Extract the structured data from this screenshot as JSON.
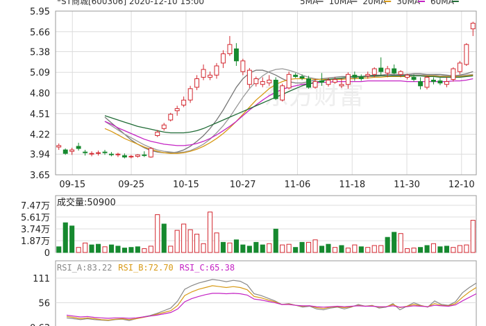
{
  "header": {
    "title": "*ST商城[600306] 2020-12-10 15:00",
    "ma_legend": [
      {
        "label": "5MA",
        "color": "#777777"
      },
      {
        "label": "10MA",
        "color": "#777777"
      },
      {
        "label": "20MA",
        "color": "#d89a16"
      },
      {
        "label": "30MA",
        "color": "#c422c4"
      },
      {
        "label": "60MA",
        "color": "#1f6b35"
      }
    ]
  },
  "volume_label": "成交量:50900",
  "rsi_legend": [
    {
      "label": "RSI_A:83.22",
      "color": "#888888"
    },
    {
      "label": "RSI_B:72.70",
      "color": "#d89a16"
    },
    {
      "label": "RSI_C:65.38",
      "color": "#c422c4"
    }
  ],
  "watermark": "东方财富",
  "colors": {
    "up": "#d3262e",
    "down": "#16892f",
    "grid": "#dcdcdc"
  },
  "chart_data": [
    {
      "type": "candlestick",
      "yticks": [
        3.65,
        3.94,
        4.22,
        4.51,
        4.8,
        5.09,
        5.38,
        5.66,
        5.95
      ],
      "ylim": [
        3.65,
        5.95
      ],
      "xticks": [
        "09-15",
        "09-25",
        "10-15",
        "10-27",
        "11-06",
        "11-18",
        "11-30",
        "12-10"
      ],
      "candles": [
        [
          4.04,
          4.09,
          4.0,
          4.06
        ],
        [
          4.0,
          4.02,
          3.93,
          3.95
        ],
        [
          3.98,
          4.03,
          3.93,
          4.0
        ],
        [
          4.05,
          4.1,
          3.99,
          4.02
        ],
        [
          3.97,
          4.0,
          3.92,
          3.96
        ],
        [
          3.94,
          3.98,
          3.91,
          3.95
        ],
        [
          3.95,
          3.99,
          3.92,
          3.96
        ],
        [
          3.97,
          4.0,
          3.93,
          3.96
        ],
        [
          3.94,
          3.97,
          3.91,
          3.93
        ],
        [
          3.93,
          3.96,
          3.9,
          3.94
        ],
        [
          3.92,
          3.95,
          3.88,
          3.9
        ],
        [
          3.9,
          3.93,
          3.88,
          3.91
        ],
        [
          3.91,
          3.94,
          3.89,
          3.93
        ],
        [
          3.93,
          3.98,
          3.9,
          3.92
        ],
        [
          3.9,
          4.04,
          3.89,
          4.02
        ],
        [
          4.2,
          4.28,
          4.18,
          4.25
        ],
        [
          4.3,
          4.38,
          4.27,
          4.35
        ],
        [
          4.42,
          4.52,
          4.4,
          4.5
        ],
        [
          4.55,
          4.62,
          4.48,
          4.58
        ],
        [
          4.63,
          4.75,
          4.6,
          4.7
        ],
        [
          4.7,
          4.9,
          4.66,
          4.86
        ],
        [
          4.88,
          5.05,
          4.84,
          5.0
        ],
        [
          5.02,
          5.2,
          4.98,
          5.13
        ],
        [
          5.02,
          5.1,
          4.98,
          5.05
        ],
        [
          5.05,
          5.22,
          5.0,
          5.18
        ],
        [
          5.22,
          5.4,
          5.15,
          5.35
        ],
        [
          5.35,
          5.6,
          5.32,
          5.48
        ],
        [
          5.42,
          5.5,
          5.18,
          5.25
        ],
        [
          5.1,
          5.28,
          5.05,
          5.25
        ],
        [
          4.92,
          5.15,
          4.87,
          5.12
        ],
        [
          4.93,
          5.03,
          4.89,
          5.0
        ],
        [
          4.92,
          5.02,
          4.88,
          4.96
        ],
        [
          4.94,
          5.05,
          4.9,
          4.98
        ],
        [
          4.98,
          5.02,
          4.7,
          4.72
        ],
        [
          4.7,
          4.93,
          4.68,
          4.9
        ],
        [
          4.87,
          5.1,
          4.85,
          5.06
        ],
        [
          5.05,
          5.08,
          5.01,
          5.03
        ],
        [
          5.03,
          5.06,
          4.98,
          5.01
        ],
        [
          5.0,
          5.04,
          4.86,
          4.88
        ],
        [
          4.88,
          5.0,
          4.86,
          4.96
        ],
        [
          4.97,
          5.08,
          4.9,
          4.95
        ],
        [
          4.92,
          5.01,
          4.89,
          4.98
        ],
        [
          4.95,
          5.02,
          4.93,
          4.99
        ],
        [
          4.9,
          5.0,
          4.87,
          4.92
        ],
        [
          4.92,
          5.09,
          4.86,
          5.06
        ],
        [
          5.05,
          5.1,
          4.97,
          5.02
        ],
        [
          5.02,
          5.06,
          4.97,
          5.0
        ],
        [
          5.04,
          5.1,
          5.0,
          5.06
        ],
        [
          5.06,
          5.16,
          5.02,
          5.14
        ],
        [
          5.15,
          5.3,
          5.05,
          5.1
        ],
        [
          5.08,
          5.18,
          5.02,
          5.14
        ],
        [
          5.14,
          5.2,
          5.06,
          5.08
        ],
        [
          5.06,
          5.12,
          5.02,
          5.1
        ],
        [
          5.02,
          5.07,
          4.99,
          5.05
        ],
        [
          5.02,
          5.06,
          4.96,
          4.99
        ],
        [
          4.96,
          5.02,
          4.85,
          4.9
        ],
        [
          4.88,
          5.04,
          4.85,
          5.02
        ],
        [
          4.98,
          5.02,
          4.92,
          4.96
        ],
        [
          4.97,
          5.01,
          4.91,
          4.94
        ],
        [
          4.92,
          5.02,
          4.88,
          4.96
        ],
        [
          4.99,
          5.16,
          4.96,
          5.14
        ],
        [
          5.1,
          5.25,
          5.06,
          5.22
        ],
        [
          5.2,
          5.5,
          5.18,
          5.48
        ],
        [
          5.7,
          5.8,
          5.6,
          5.78
        ]
      ],
      "moving_averages": {
        "MA5": [
          4.46,
          4.38,
          4.3,
          4.22,
          4.14,
          4.08,
          4.03,
          3.99,
          3.97,
          3.96,
          3.96,
          3.97,
          4.0,
          4.05,
          4.12,
          4.2,
          4.3,
          4.42,
          4.56,
          4.72,
          4.88,
          5.0,
          5.08,
          5.12,
          5.12,
          5.09,
          5.05,
          5.0,
          4.96,
          4.94,
          4.94,
          4.96,
          4.98,
          5.0,
          5.01,
          5.02,
          5.03,
          5.03,
          5.03,
          5.03,
          5.04,
          5.05,
          5.05,
          5.06,
          5.06,
          5.06,
          5.06,
          5.07,
          5.07,
          5.06,
          5.06,
          5.06,
          5.05,
          5.04,
          5.05,
          5.07,
          5.1
        ],
        "MA10": [
          4.4,
          4.34,
          4.28,
          4.22,
          4.17,
          4.12,
          4.07,
          4.03,
          4.0,
          3.98,
          3.97,
          3.96,
          3.97,
          3.99,
          4.03,
          4.08,
          4.15,
          4.24,
          4.34,
          4.46,
          4.6,
          4.74,
          4.86,
          4.96,
          5.04,
          5.1,
          5.13,
          5.14,
          5.12,
          5.09,
          5.05,
          5.02,
          5.0,
          4.99,
          4.99,
          4.99,
          5.0,
          5.0,
          5.01,
          5.02,
          5.03,
          5.03,
          5.04,
          5.04,
          5.05,
          5.05,
          5.05,
          5.05,
          5.05,
          5.05,
          5.05,
          5.04,
          5.04,
          5.03,
          5.04,
          5.05,
          5.06
        ],
        "MA20": [
          4.3,
          4.26,
          4.21,
          4.16,
          4.12,
          4.08,
          4.04,
          4.01,
          3.98,
          3.96,
          3.95,
          3.95,
          3.96,
          3.98,
          4.01,
          4.05,
          4.1,
          4.16,
          4.23,
          4.31,
          4.4,
          4.5,
          4.6,
          4.7,
          4.78,
          4.86,
          4.92,
          4.96,
          4.99,
          5.0,
          5.0,
          5.0,
          4.99,
          4.99,
          4.99,
          4.99,
          4.99,
          5.0,
          5.0,
          5.01,
          5.01,
          5.02,
          5.02,
          5.03,
          5.03,
          5.03,
          5.03,
          5.04,
          5.04,
          5.04,
          5.04,
          5.03,
          5.03,
          5.03,
          5.03,
          5.04,
          5.05
        ],
        "MA30": [
          4.4,
          4.36,
          4.31,
          4.27,
          4.23,
          4.19,
          4.15,
          4.12,
          4.1,
          4.08,
          4.07,
          4.06,
          4.06,
          4.07,
          4.09,
          4.12,
          4.16,
          4.21,
          4.27,
          4.33,
          4.4,
          4.48,
          4.56,
          4.63,
          4.7,
          4.76,
          4.81,
          4.85,
          4.88,
          4.9,
          4.92,
          4.93,
          4.94,
          4.95,
          4.95,
          4.96,
          4.96,
          4.96,
          4.96,
          4.96,
          4.97,
          4.97,
          4.97,
          4.97,
          4.97,
          4.97,
          4.96,
          4.96,
          4.96,
          4.96,
          4.96,
          4.96,
          4.96,
          4.97,
          4.97,
          4.98,
          5.0
        ],
        "MA60": [
          4.48,
          4.45,
          4.42,
          4.39,
          4.36,
          4.33,
          4.31,
          4.29,
          4.27,
          4.25,
          4.24,
          4.24,
          4.24,
          4.25,
          4.27,
          4.3,
          4.34,
          4.38,
          4.42,
          4.46,
          4.5,
          4.54,
          4.58,
          4.62,
          4.66,
          4.7,
          4.74,
          4.78,
          4.82,
          4.86,
          4.9,
          4.93,
          4.95,
          4.97,
          4.99,
          5.0,
          5.01,
          5.02,
          5.03,
          5.03,
          5.04,
          5.04,
          5.04,
          5.04,
          5.04,
          5.04,
          5.04,
          5.04,
          5.04,
          5.03,
          5.03,
          5.02,
          5.02,
          5.02,
          5.02,
          5.03,
          5.04
        ]
      }
    },
    {
      "type": "bar",
      "ylabel": "成交量",
      "yticks": [
        "7.47万",
        "5.61万",
        "3.74万",
        "1.87万",
        "0"
      ],
      "ylim": [
        0,
        7.47
      ],
      "values": [
        0.9,
        4.7,
        4.2,
        0.8,
        1.5,
        1.2,
        1.3,
        0.9,
        1.2,
        1.0,
        0.7,
        0.8,
        0.9,
        0.6,
        1.0,
        6.0,
        4.5,
        1.0,
        3.5,
        4.5,
        3.6,
        2.9,
        1.4,
        6.4,
        3.1,
        1.6,
        1.5,
        2.0,
        1.2,
        1.0,
        1.6,
        1.2,
        1.4,
        3.7,
        1.2,
        1.3,
        0.8,
        1.6,
        1.6,
        2.0,
        1.0,
        1.3,
        0.8,
        1.1,
        0.7,
        1.2,
        0.9,
        0.8,
        1.1,
        1.1,
        2.4,
        3.2,
        3.0,
        0.6,
        0.7,
        0.8,
        1.1,
        1.4,
        0.9,
        1.0,
        0.8,
        1.1,
        1.2,
        5.1
      ],
      "updown": [
        "d",
        "d",
        "d",
        "u",
        "u",
        "d",
        "d",
        "u",
        "d",
        "d",
        "d",
        "d",
        "d",
        "u",
        "u",
        "u",
        "d",
        "u",
        "u",
        "u",
        "u",
        "u",
        "u",
        "u",
        "u",
        "d",
        "u",
        "d",
        "d",
        "d",
        "d",
        "d",
        "u",
        "d",
        "u",
        "u",
        "d",
        "d",
        "u",
        "u",
        "d",
        "d",
        "u",
        "d",
        "u",
        "u",
        "d",
        "u",
        "u",
        "u",
        "d",
        "d",
        "u",
        "u",
        "u",
        "d",
        "d",
        "u",
        "d",
        "d",
        "u",
        "u",
        "u",
        "u"
      ]
    },
    {
      "type": "line",
      "yticks": [
        111,
        56,
        0.63
      ],
      "ylim": [
        0.63,
        111
      ],
      "series": [
        {
          "name": "RSI_A",
          "color": "#888888",
          "values": [
            22,
            20,
            18,
            20,
            18,
            17,
            16,
            18,
            19,
            16,
            20,
            24,
            27,
            32,
            38,
            44,
            60,
            86,
            94,
            100,
            104,
            108,
            106,
            103,
            106,
            104,
            96,
            76,
            72,
            66,
            60,
            52,
            54,
            50,
            46,
            48,
            42,
            40,
            44,
            46,
            42,
            46,
            52,
            48,
            50,
            44,
            46,
            54,
            40,
            48,
            56,
            50,
            46,
            60,
            52,
            50,
            58,
            78,
            90,
            100
          ]
        },
        {
          "name": "RSI_B",
          "color": "#d89a16",
          "values": [
            25,
            23,
            20,
            22,
            20,
            18,
            17,
            19,
            20,
            18,
            20,
            23,
            26,
            30,
            34,
            38,
            50,
            72,
            80,
            86,
            90,
            94,
            92,
            90,
            92,
            90,
            85,
            70,
            67,
            62,
            58,
            52,
            53,
            50,
            48,
            49,
            45,
            43,
            46,
            47,
            45,
            47,
            50,
            48,
            49,
            46,
            47,
            52,
            45,
            48,
            52,
            49,
            47,
            54,
            50,
            49,
            54,
            68,
            80,
            90
          ]
        },
        {
          "name": "RSI_C",
          "color": "#c422c4",
          "values": [
            28,
            26,
            24,
            25,
            23,
            22,
            21,
            22,
            22,
            21,
            22,
            24,
            26,
            28,
            31,
            34,
            42,
            58,
            65,
            70,
            74,
            77,
            77,
            76,
            77,
            76,
            73,
            64,
            62,
            59,
            56,
            52,
            52,
            50,
            49,
            49,
            47,
            46,
            47,
            48,
            47,
            48,
            49,
            48,
            48,
            47,
            47,
            49,
            46,
            47,
            49,
            48,
            47,
            50,
            49,
            48,
            51,
            60,
            68,
            76
          ]
        }
      ]
    }
  ]
}
